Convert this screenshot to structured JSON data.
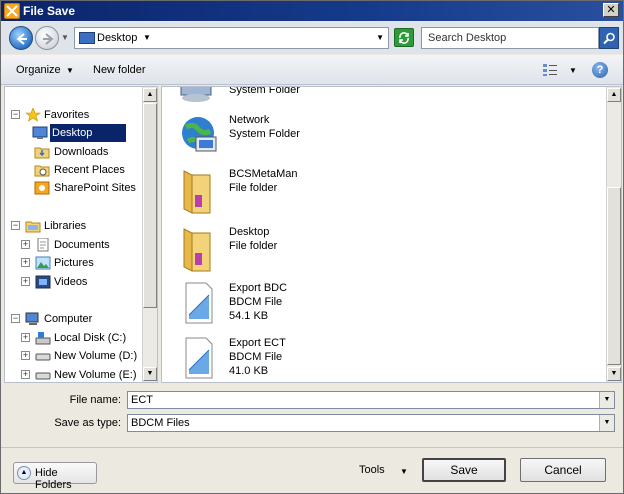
{
  "window": {
    "title": "File Save",
    "close_label": "✕"
  },
  "address": {
    "location": "Desktop",
    "search_placeholder": "Search Desktop"
  },
  "toolbar": {
    "organize_label": "Organize",
    "new_folder_label": "New folder"
  },
  "nav": {
    "favorites": "Favorites",
    "desktop": "Desktop",
    "downloads": "Downloads",
    "recent_places": "Recent Places",
    "sharepoint_sites": "SharePoint Sites",
    "libraries": "Libraries",
    "documents": "Documents",
    "pictures": "Pictures",
    "videos": "Videos",
    "computer": "Computer",
    "local_disk": "Local Disk (C:)",
    "new_volume_d": "New Volume (D:)",
    "new_volume_e": "New Volume (E:)"
  },
  "files": [
    {
      "name": "",
      "type": "System Folder",
      "size": ""
    },
    {
      "name": "Network",
      "type": "System Folder",
      "size": ""
    },
    {
      "name": "BCSMetaMan",
      "type": "File folder",
      "size": ""
    },
    {
      "name": "Desktop",
      "type": "File folder",
      "size": ""
    },
    {
      "name": "Export BDC",
      "type": "BDCM File",
      "size": "54.1 KB"
    },
    {
      "name": "Export ECT",
      "type": "BDCM File",
      "size": "41.0 KB"
    }
  ],
  "form": {
    "file_name_label": "File name:",
    "file_name_value": "ECT",
    "save_as_type_label": "Save as type:",
    "save_as_type_value": "BDCM Files"
  },
  "footer": {
    "hide_folders_label": "Hide Folders",
    "tools_label": "Tools",
    "save_label": "Save",
    "cancel_label": "Cancel"
  },
  "colors": {
    "titlebar": "#0a246a",
    "selection": "#0a246a",
    "folder": "#f3d37a"
  }
}
